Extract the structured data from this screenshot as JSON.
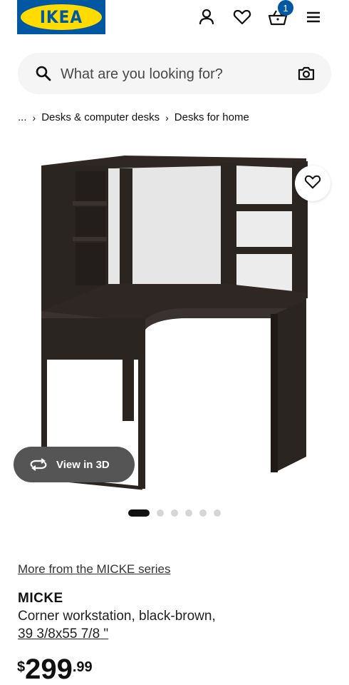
{
  "header": {
    "logo_text": "IKEA",
    "cart_count": "1",
    "icons": [
      "profile-icon",
      "heart-icon",
      "cart-icon",
      "menu-icon"
    ]
  },
  "search": {
    "placeholder": "What are you looking for?",
    "value": ""
  },
  "breadcrumb": {
    "ellipsis": "...",
    "items": [
      "Desks & computer desks",
      "Desks for home"
    ]
  },
  "product": {
    "view_3d_label": "View in 3D",
    "carousel": {
      "total": 6,
      "active": 1
    },
    "series_link": "More from the MICKE series",
    "name": "MICKE",
    "description": "Corner workstation, black-brown,",
    "dimensions": "39 3/8x55 7/8 \"",
    "price": {
      "currency": "$",
      "integer": "299",
      "decimals": ".99"
    }
  },
  "colors": {
    "ikea_blue": "#0058a3",
    "ikea_yellow": "#ffdb00",
    "desk": "#2b2522"
  }
}
